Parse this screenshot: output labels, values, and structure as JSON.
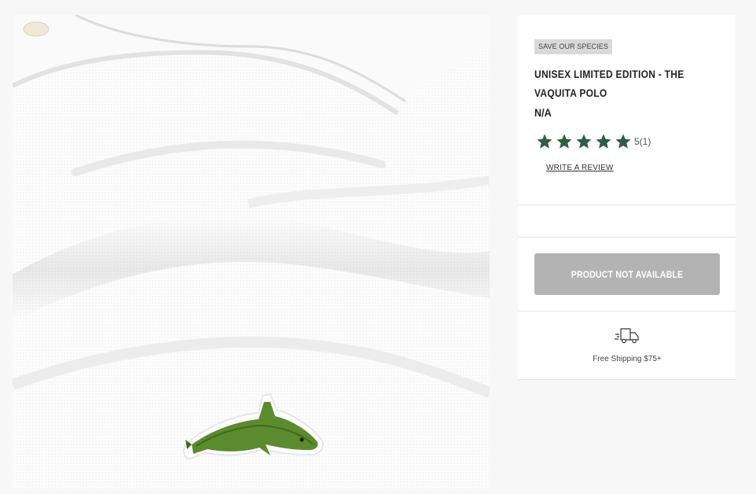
{
  "product": {
    "badge": "SAVE OUR SPECIES",
    "title": "UNISEX LIMITED EDITION - THE VAQUITA POLO",
    "price": "N/A",
    "rating": {
      "value": 5,
      "max": 5,
      "text": "5(1)",
      "star_color": "#2f5e46"
    },
    "write_review": "WRITE A REVIEW",
    "cta_label": "PRODUCT NOT AVAILABLE",
    "cta_color": "#b3b3b3",
    "shipping_text": "Free Shipping $75+",
    "shipping_icon": "delivery-truck-icon",
    "image_alt": "White polo shirt with embroidered green vaquita logo"
  }
}
